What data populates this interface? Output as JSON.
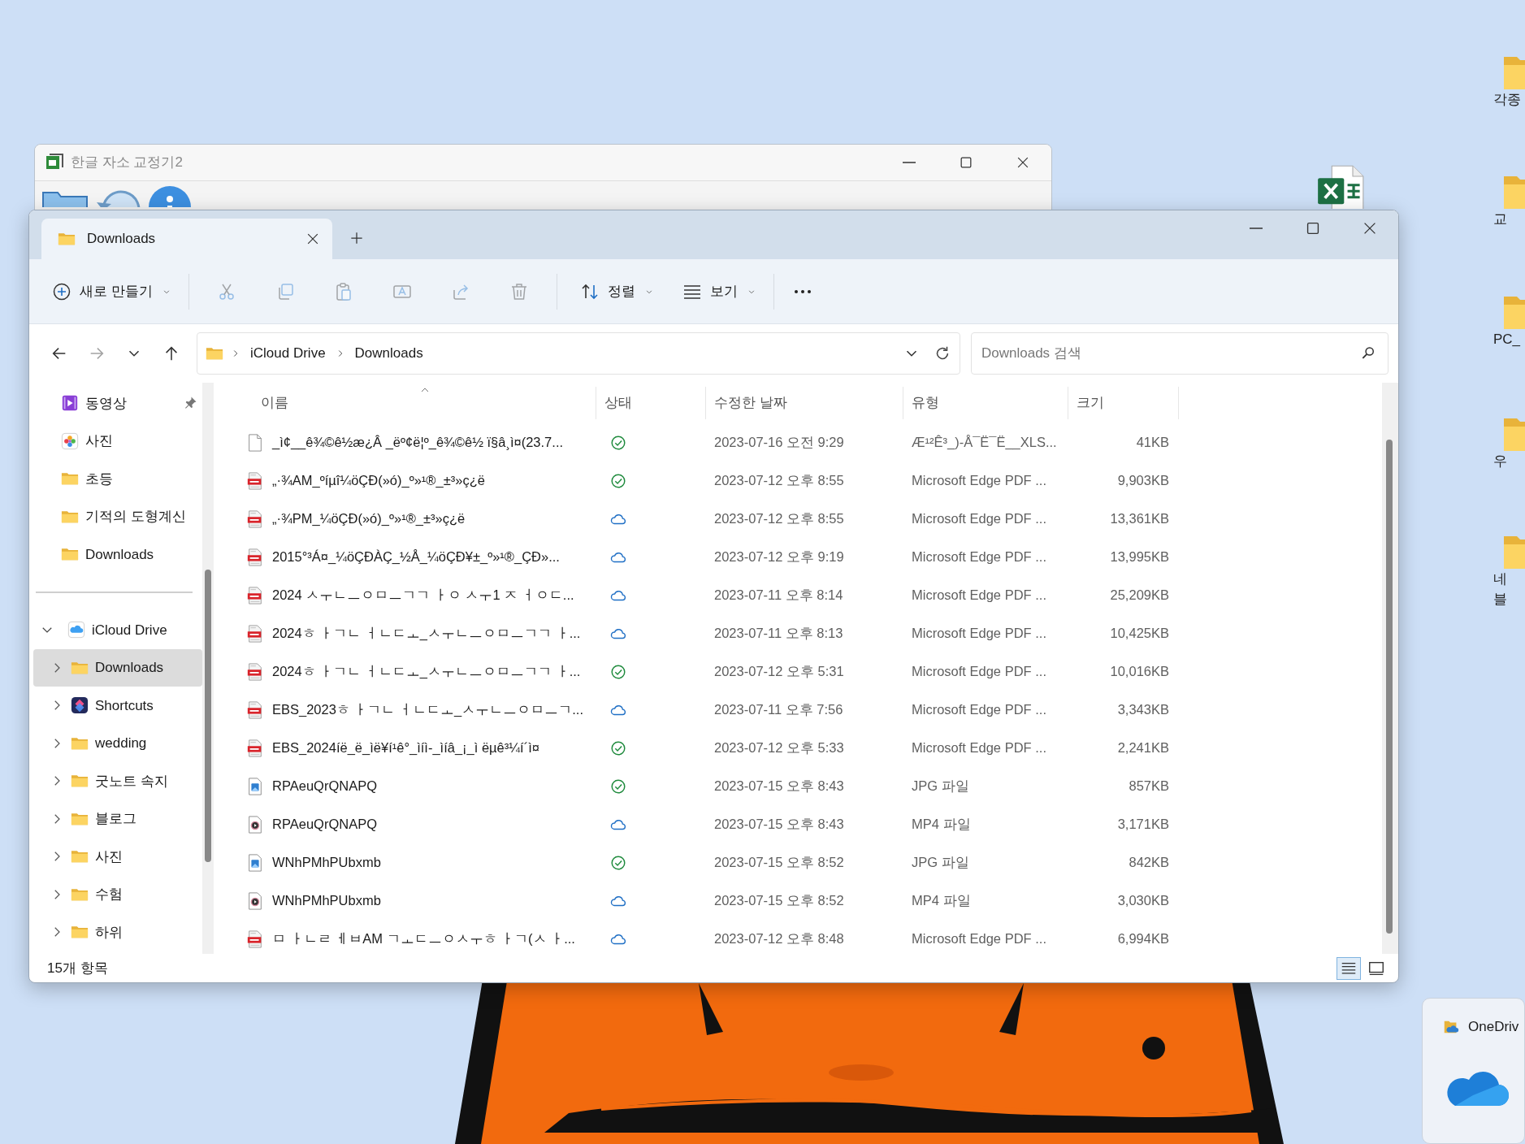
{
  "desktop_icons": [
    {
      "lines": [
        "각종"
      ]
    },
    {
      "lines": [
        "교"
      ]
    },
    {
      "lines": [
        "PC_"
      ]
    },
    {
      "lines": [
        "우"
      ]
    },
    {
      "lines": [
        "네",
        "블"
      ]
    }
  ],
  "background_window": {
    "title": "한글 자소 교정기2"
  },
  "explorer": {
    "tabs": [
      {
        "label": "Downloads",
        "selected": true
      }
    ],
    "toolbar": {
      "new_label": "새로 만들기",
      "actions": [
        {
          "kind": "cut",
          "disabled": true
        },
        {
          "kind": "copy",
          "disabled": true
        },
        {
          "kind": "paste",
          "disabled": true
        },
        {
          "kind": "rename",
          "disabled": true
        },
        {
          "kind": "share",
          "disabled": true
        },
        {
          "kind": "delete",
          "disabled": true
        }
      ],
      "sort_label": "정렬",
      "view_label": "보기"
    },
    "navigation": [
      {
        "kind": "back",
        "disabled": false
      },
      {
        "kind": "forward",
        "disabled": true
      },
      {
        "kind": "recent",
        "disabled": false
      },
      {
        "kind": "up",
        "disabled": false
      }
    ],
    "breadcrumb": [
      "iCloud Drive",
      "Downloads"
    ],
    "search": {
      "placeholder": "Downloads 검색"
    },
    "sidebar": {
      "quick_access": [
        {
          "kind": "video",
          "label": "동영상",
          "pinned": true,
          "selected": false
        },
        {
          "kind": "photos",
          "label": "사진",
          "pinned": false,
          "selected": false
        },
        {
          "kind": "folder",
          "label": "초등",
          "pinned": false,
          "selected": false
        },
        {
          "kind": "folder",
          "label": "기적의 도형계신",
          "pinned": false,
          "selected": false
        },
        {
          "kind": "folder",
          "label": "Downloads",
          "pinned": false,
          "selected": false
        }
      ],
      "tree": [
        {
          "kind": "icloud",
          "label": "iCloud Drive",
          "expanded": true,
          "selected": false,
          "children": [
            {
              "kind": "folder",
              "label": "Downloads",
              "expanded": false,
              "selected": true
            },
            {
              "kind": "shortcuts",
              "label": "Shortcuts",
              "expanded": false,
              "selected": false
            },
            {
              "kind": "folder",
              "label": "wedding",
              "expanded": false,
              "selected": false
            },
            {
              "kind": "folder",
              "label": "굿노트 속지",
              "expanded": false,
              "selected": false
            },
            {
              "kind": "folder",
              "label": "블로그",
              "expanded": false,
              "selected": false
            },
            {
              "kind": "folder",
              "label": "사진",
              "expanded": false,
              "selected": false
            },
            {
              "kind": "folder",
              "label": "수험",
              "expanded": false,
              "selected": false
            },
            {
              "kind": "folder",
              "label": "하위",
              "expanded": false,
              "selected": false
            }
          ]
        }
      ]
    },
    "columns": [
      {
        "label": "이름",
        "sorted": true
      },
      {
        "label": "상태",
        "sorted": false
      },
      {
        "label": "수정한 날짜",
        "sorted": false
      },
      {
        "label": "유형",
        "sorted": false
      },
      {
        "label": "크기",
        "sorted": false
      }
    ],
    "files": [
      {
        "kind": "blank",
        "name": "_ì¢__ê¾©ê½æ¿Â _ëº¢ë¦º_ê¾©ê½ ï§â¸ì¤(23.7...",
        "synced": true,
        "modified": "2023-07-16 오전 9:29",
        "type": "Æ¹²Ê³_)-Å¯Ë¯Ë__XLS...",
        "size": "41KB"
      },
      {
        "kind": "pdf",
        "name": "„·¾AM_ºíµî¼öÇÐ(»ó)_º»¹®_±³»ç¿ë",
        "synced": true,
        "modified": "2023-07-12 오후 8:55",
        "type": "Microsoft Edge PDF ...",
        "size": "9,903KB"
      },
      {
        "kind": "pdf",
        "name": "„·¾PM_¼öÇÐ(»ó)_º»¹®_±³»ç¿ë",
        "synced": false,
        "modified": "2023-07-12 오후 8:55",
        "type": "Microsoft Edge PDF ...",
        "size": "13,361KB"
      },
      {
        "kind": "pdf",
        "name": "2015°³Á¤_¼öÇÐÀÇ_½Å_¼öÇÐ¥±_º»¹®_ÇÐ»...",
        "synced": false,
        "modified": "2023-07-12 오후 9:19",
        "type": "Microsoft Edge PDF ...",
        "size": "13,995KB"
      },
      {
        "kind": "pdf",
        "name": "2024 ㅅㅜㄴㅡㅇㅁㅡㄱㄱ ㅏㅇ ㅅㅜ1 ㅈ ㅓㅇㄷ...",
        "synced": false,
        "modified": "2023-07-11 오후 8:14",
        "type": "Microsoft Edge PDF ...",
        "size": "25,209KB"
      },
      {
        "kind": "pdf",
        "name": "2024ㅎ ㅏㄱㄴ ㅓㄴㄷㅗ_ㅅㅜㄴㅡㅇㅁㅡㄱㄱ ㅏ...",
        "synced": false,
        "modified": "2023-07-11 오후 8:13",
        "type": "Microsoft Edge PDF ...",
        "size": "10,425KB"
      },
      {
        "kind": "pdf",
        "name": "2024ㅎ ㅏㄱㄴ ㅓㄴㄷㅗ_ㅅㅜㄴㅡㅇㅁㅡㄱㄱ ㅏ...",
        "synced": true,
        "modified": "2023-07-12 오후 5:31",
        "type": "Microsoft Edge PDF ...",
        "size": "10,016KB"
      },
      {
        "kind": "pdf",
        "name": "EBS_2023ㅎ ㅏㄱㄴ ㅓㄴㄷㅗ_ㅅㅜㄴㅡㅇㅁㅡㄱ...",
        "synced": false,
        "modified": "2023-07-11 오후 7:56",
        "type": "Microsoft Edge PDF ...",
        "size": "3,343KB"
      },
      {
        "kind": "pdf",
        "name": "EBS_2024íë_ë_ìë¥í¹ê°_ìíì-_ìíâ_¡_ì ëµê³¼í´ì¤",
        "synced": true,
        "modified": "2023-07-12 오후 5:33",
        "type": "Microsoft Edge PDF ...",
        "size": "2,241KB"
      },
      {
        "kind": "jpg",
        "name": "RPAeuQrQNAPQ",
        "synced": true,
        "modified": "2023-07-15 오후 8:43",
        "type": "JPG 파일",
        "size": "857KB"
      },
      {
        "kind": "mp4",
        "name": "RPAeuQrQNAPQ",
        "synced": false,
        "modified": "2023-07-15 오후 8:43",
        "type": "MP4 파일",
        "size": "3,171KB"
      },
      {
        "kind": "jpg",
        "name": "WNhPMhPUbxmb",
        "synced": true,
        "modified": "2023-07-15 오후 8:52",
        "type": "JPG 파일",
        "size": "842KB"
      },
      {
        "kind": "mp4",
        "name": "WNhPMhPUbxmb",
        "synced": false,
        "modified": "2023-07-15 오후 8:52",
        "type": "MP4 파일",
        "size": "3,030KB"
      },
      {
        "kind": "pdf",
        "name": "ㅁ ㅏㄴㄹ ㅔㅂAM ㄱㅗㄷㅡㅇㅅㅜㅎ ㅏㄱ(ㅅ ㅏ...",
        "synced": false,
        "modified": "2023-07-12 오후 8:48",
        "type": "Microsoft Edge PDF ...",
        "size": "6,994KB"
      }
    ],
    "status_bar": {
      "item_count": "15개 항목"
    },
    "view_modes": [
      {
        "kind": "details",
        "selected": true
      },
      {
        "kind": "tiles",
        "selected": false
      }
    ]
  },
  "onedrive_popup": {
    "title": "OneDriv"
  }
}
